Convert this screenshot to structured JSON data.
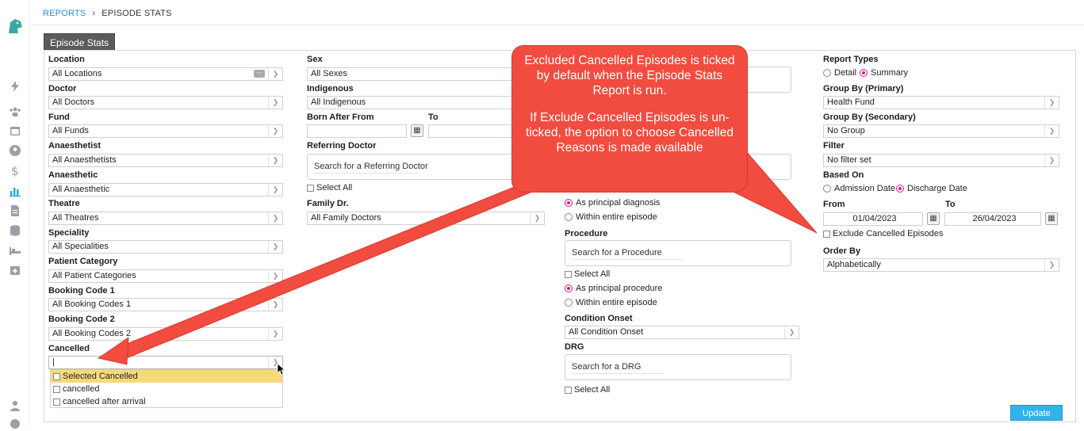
{
  "breadcrumb": {
    "reports": "REPORTS",
    "separator": "›",
    "current": "EPISODE STATS"
  },
  "tab": {
    "label": "Episode Stats"
  },
  "col1": {
    "location": {
      "label": "Location",
      "value": "All Locations"
    },
    "doctor": {
      "label": "Doctor",
      "value": "All Doctors"
    },
    "fund": {
      "label": "Fund",
      "value": "All Funds"
    },
    "anaesthetist": {
      "label": "Anaesthetist",
      "value": "All Anaesthetists"
    },
    "anaesthetic": {
      "label": "Anaesthetic",
      "value": "All Anaesthetic"
    },
    "theatre": {
      "label": "Theatre",
      "value": "All Theatres"
    },
    "speciality": {
      "label": "Speciality",
      "value": "All Specialities"
    },
    "patient_category": {
      "label": "Patient Category",
      "value": "All Patient Categories"
    },
    "booking_code_1": {
      "label": "Booking Code 1",
      "value": "All Booking Codes 1"
    },
    "booking_code_2": {
      "label": "Booking Code 2",
      "value": "All Booking Codes 2"
    },
    "cancelled": {
      "label": "Cancelled",
      "value": "|"
    }
  },
  "cancelled_dropdown": {
    "items": [
      "Selected Cancelled",
      "cancelled",
      "cancelled after arrival"
    ]
  },
  "col2": {
    "sex": {
      "label": "Sex",
      "value": "All Sexes"
    },
    "indigenous": {
      "label": "Indigenous",
      "value": "All Indigenous"
    },
    "born_after_from": {
      "label": "Born After From",
      "value": ""
    },
    "born_to": {
      "label": "To",
      "value": ""
    },
    "referring_doctor": {
      "label": "Referring Doctor",
      "placeholder": "Search for a Referring Doctor"
    },
    "select_all": "Select All",
    "family_dr": {
      "label": "Family Dr.",
      "value": "All Family Doctors"
    }
  },
  "col3": {
    "diagnosis_principal": "As principal diagnosis",
    "diagnosis_entire": "Within entire episode",
    "procedure": {
      "label": "Procedure",
      "placeholder": "Search for a Procedure"
    },
    "procedure_select_all": "Select All",
    "procedure_principal": "As principal procedure",
    "procedure_entire": "Within entire episode",
    "condition_onset": {
      "label": "Condition Onset",
      "value": "All Condition Onset"
    },
    "drg": {
      "label": "DRG",
      "placeholder": "Search for a DRG"
    },
    "drg_select_all": "Select All"
  },
  "col4": {
    "report_types": {
      "label": "Report Types",
      "detail": "Detail",
      "summary": "Summary",
      "selected": "Summary"
    },
    "group_by_primary": {
      "label": "Group By (Primary)",
      "value": "Health Fund"
    },
    "group_by_secondary": {
      "label": "Group By (Secondary)",
      "value": "No Group"
    },
    "filter": {
      "label": "Filter",
      "value": "No filter set"
    },
    "based_on": {
      "label": "Based On",
      "admission": "Admission Date",
      "discharge": "Discharge Date",
      "selected": "Discharge Date"
    },
    "from": {
      "label": "From",
      "value": "01/04/2023"
    },
    "to": {
      "label": "To",
      "value": "26/04/2023"
    },
    "exclude_cancelled": "Exclude Cancelled Episodes",
    "order_by": {
      "label": "Order By",
      "value": "Alphabetically"
    }
  },
  "update_button": "Update",
  "callout": {
    "para1": "Excluded Cancelled Episodes is ticked by default when the Episode Stats Report is run.",
    "para2": "If Exclude Cancelled Episodes is un-ticked, the option to choose Cancelled Reasons is made available"
  },
  "colors": {
    "accent": "#2aa3d8",
    "callout": "#f24b3f",
    "highlight": "#f8d87c",
    "radio": "#e2197f"
  }
}
